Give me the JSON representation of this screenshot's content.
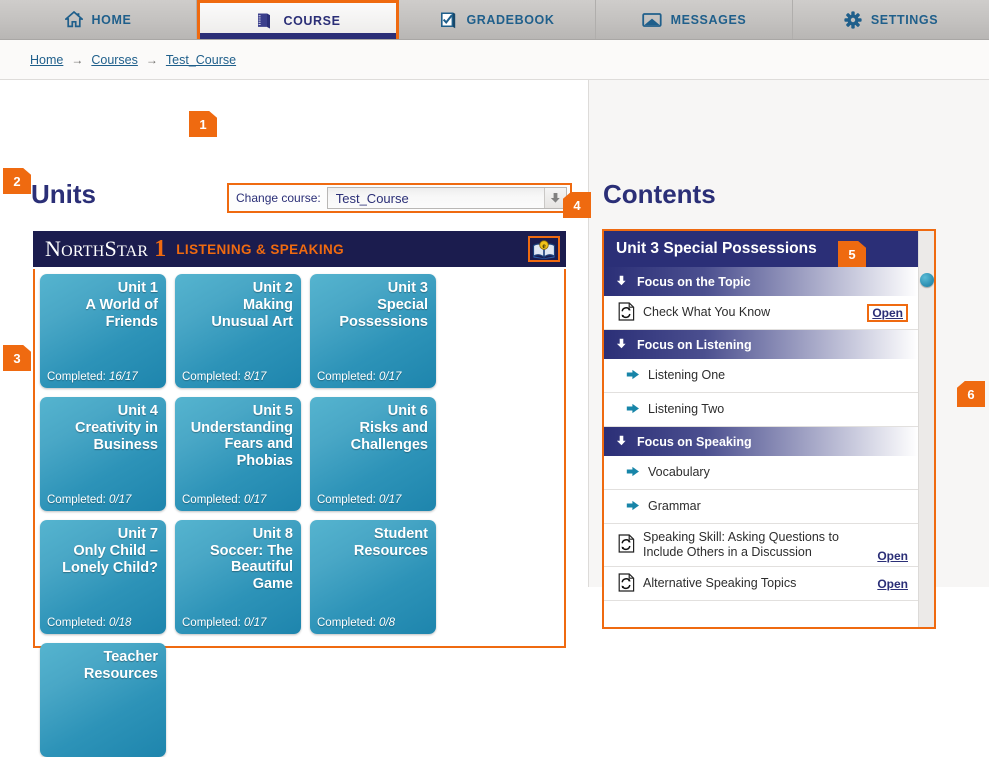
{
  "nav": {
    "tabs": [
      {
        "label": "HOME",
        "icon": "home-icon",
        "active": false
      },
      {
        "label": "COURSE",
        "icon": "book-icon",
        "active": true
      },
      {
        "label": "GRADEBOOK",
        "icon": "checkbook-icon",
        "active": false
      },
      {
        "label": "MESSAGES",
        "icon": "envelope-icon",
        "active": false
      },
      {
        "label": "SETTINGS",
        "icon": "gear-icon",
        "active": false
      }
    ]
  },
  "breadcrumb": {
    "items": [
      "Home",
      "Courses",
      "Test_Course"
    ],
    "separator": "→"
  },
  "left": {
    "heading": "Units",
    "course_selector": {
      "label": "Change course:",
      "value": "Test_Course",
      "arrow_icon": "chevron-down-icon"
    },
    "banner": {
      "logo_n": "N",
      "logo_orth": "ORTH",
      "logo_s": "S",
      "logo_tar": "TAR",
      "level": "1",
      "subtitle": "LISTENING & SPEAKING",
      "ebook_icon": "ebook-icon"
    },
    "tiles": [
      {
        "title": "Unit 1\nA World of\nFriends",
        "completed_label": "Completed:",
        "completed_value": "16/17"
      },
      {
        "title": "Unit 2\nMaking\nUnusual Art",
        "completed_label": "Completed:",
        "completed_value": "8/17"
      },
      {
        "title": "Unit 3\nSpecial\nPossessions",
        "completed_label": "Completed:",
        "completed_value": "0/17"
      },
      {
        "title": "Unit 4\nCreativity in\nBusiness",
        "completed_label": "Completed:",
        "completed_value": "0/17"
      },
      {
        "title": "Unit 5\nUnderstanding\nFears and\nPhobias",
        "completed_label": "Completed:",
        "completed_value": "0/17"
      },
      {
        "title": "Unit 6\nRisks and\nChallenges",
        "completed_label": "Completed:",
        "completed_value": "0/17"
      },
      {
        "title": "Unit 7\nOnly Child –\nLonely Child?",
        "completed_label": "Completed:",
        "completed_value": "0/18"
      },
      {
        "title": "Unit 8\nSoccer: The\nBeautiful\nGame",
        "completed_label": "Completed:",
        "completed_value": "0/17"
      },
      {
        "title": "Student\nResources",
        "completed_label": "Completed:",
        "completed_value": "0/8"
      },
      {
        "title": "Teacher\nResources",
        "completed_label": "",
        "completed_value": ""
      }
    ]
  },
  "right": {
    "heading": "Contents",
    "unit_title": "Unit 3 Special Possessions",
    "rows": [
      {
        "kind": "section",
        "label": "Focus on the Topic",
        "icon": "arrow-down-icon"
      },
      {
        "kind": "item",
        "label": "Check What You Know",
        "icon": "refresh-doc-icon",
        "open_label": "Open",
        "boxed": true
      },
      {
        "kind": "section",
        "label": "Focus on Listening",
        "icon": "arrow-down-icon"
      },
      {
        "kind": "item",
        "label": "Listening One",
        "icon": "arrow-right-icon",
        "open_label": ""
      },
      {
        "kind": "item",
        "label": "Listening Two",
        "icon": "arrow-right-icon",
        "open_label": ""
      },
      {
        "kind": "section",
        "label": "Focus on Speaking",
        "icon": "arrow-down-icon"
      },
      {
        "kind": "item",
        "label": "Vocabulary",
        "icon": "arrow-right-icon",
        "open_label": ""
      },
      {
        "kind": "item",
        "label": "Grammar",
        "icon": "arrow-right-icon",
        "open_label": ""
      },
      {
        "kind": "item2",
        "label": "Speaking Skill: Asking Questions to Include Others in a Discussion",
        "icon": "refresh-doc-icon",
        "open_label": "Open",
        "boxed": false
      },
      {
        "kind": "item",
        "label": "Alternative Speaking Topics",
        "icon": "refresh-doc-icon",
        "open_label": "Open",
        "boxed": false
      }
    ],
    "scrollbar": {
      "thumb_icon": "scroll-thumb"
    }
  },
  "callouts": [
    {
      "n": "1"
    },
    {
      "n": "2"
    },
    {
      "n": "3"
    },
    {
      "n": "4"
    },
    {
      "n": "5"
    },
    {
      "n": "6"
    }
  ],
  "colors": {
    "accent_orange": "#ef6a10",
    "navy": "#2b2f77",
    "deep_navy": "#1b1c4e",
    "tile_teal": "#2d93b8",
    "link_blue": "#1f5f8b"
  }
}
